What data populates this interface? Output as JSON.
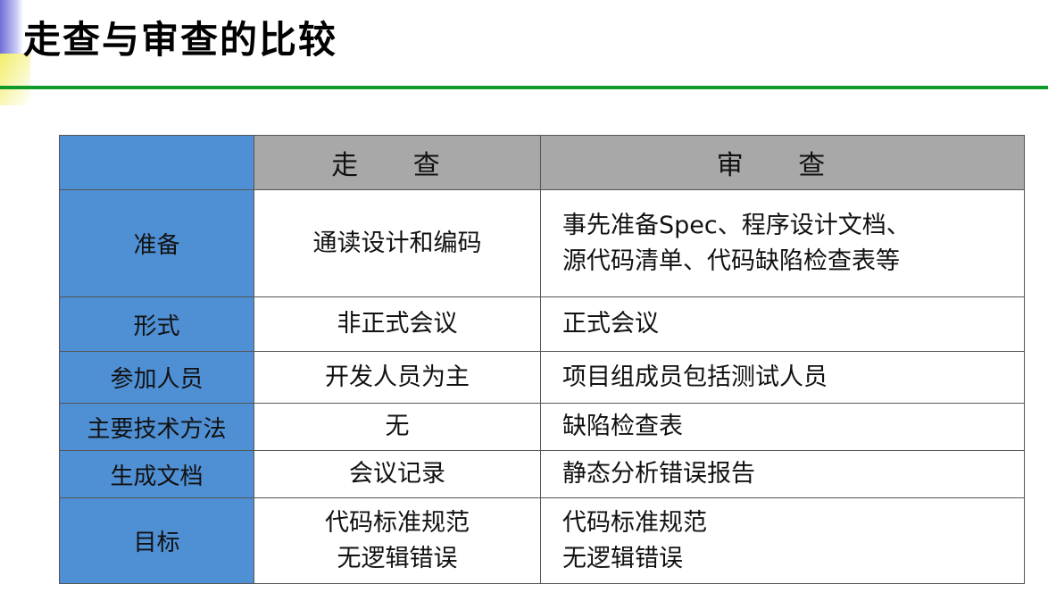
{
  "slide": {
    "title": "走查与审查的比较"
  },
  "table": {
    "columns": [
      "",
      "走 查",
      "审 查"
    ],
    "rows": [
      {
        "label": "准备",
        "walkthrough": [
          "通读设计和编码"
        ],
        "inspection": [
          "事先准备Spec、程序设计文档、",
          "源代码清单、代码缺陷检查表等"
        ]
      },
      {
        "label": "形式",
        "walkthrough": [
          "非正式会议"
        ],
        "inspection": [
          "正式会议"
        ]
      },
      {
        "label": "参加人员",
        "walkthrough": [
          "开发人员为主"
        ],
        "inspection": [
          "项目组成员包括测试人员"
        ]
      },
      {
        "label": "主要技术方法",
        "walkthrough": [
          "无"
        ],
        "inspection": [
          "缺陷检查表"
        ]
      },
      {
        "label": "生成文档",
        "walkthrough": [
          "会议记录"
        ],
        "inspection": [
          "静态分析错误报告"
        ]
      },
      {
        "label": "目标",
        "walkthrough": [
          "代码标准规范",
          "无逻辑错误"
        ],
        "inspection": [
          "代码标准规范",
          "无逻辑错误"
        ]
      }
    ]
  },
  "colors": {
    "row_header": "#4f8fd3",
    "column_header": "#a8a8a8",
    "title_rule": "#0f9b2c"
  }
}
